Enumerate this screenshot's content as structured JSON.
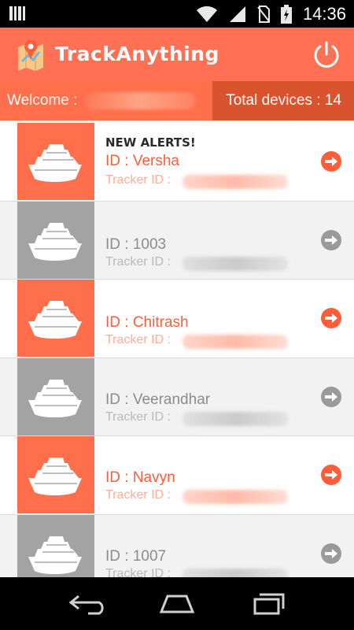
{
  "status_bar": {
    "time": "14:36",
    "icons": [
      "signal-bars-icon",
      "wifi-icon",
      "cell-signal-icon",
      "no-sim-icon",
      "battery-charging-icon"
    ]
  },
  "app_bar": {
    "title": "TrackAnything",
    "logo_icon": "map-pin-icon",
    "power_icon": "power-icon",
    "brand_color": "#ff7055"
  },
  "welcome_bar": {
    "welcome_label": "Welcome :",
    "total_devices_label": "Total devices : 14"
  },
  "devices": [
    {
      "alert": "NEW ALERTS!",
      "id_label": "ID : Versha",
      "tracker_label": "Tracker ID :",
      "status": "active"
    },
    {
      "alert": "",
      "id_label": "ID : 1003",
      "tracker_label": "Tracker ID :",
      "status": "inactive"
    },
    {
      "alert": "",
      "id_label": "ID : Chitrash",
      "tracker_label": "Tracker ID :",
      "status": "active"
    },
    {
      "alert": "",
      "id_label": "ID : Veerandhar",
      "tracker_label": "Tracker ID :",
      "status": "inactive"
    },
    {
      "alert": "",
      "id_label": "ID : Navyn",
      "tracker_label": "Tracker ID :",
      "status": "active"
    },
    {
      "alert": "",
      "id_label": "ID : 1007",
      "tracker_label": "Tracker ID :",
      "status": "inactive"
    }
  ],
  "nav_bar": {
    "icons": [
      "back-icon",
      "home-icon",
      "recents-icon"
    ]
  },
  "colors": {
    "active": "#ff6f4c",
    "inactive": "#a3a3a3",
    "welcome_dark": "#d9542e"
  }
}
